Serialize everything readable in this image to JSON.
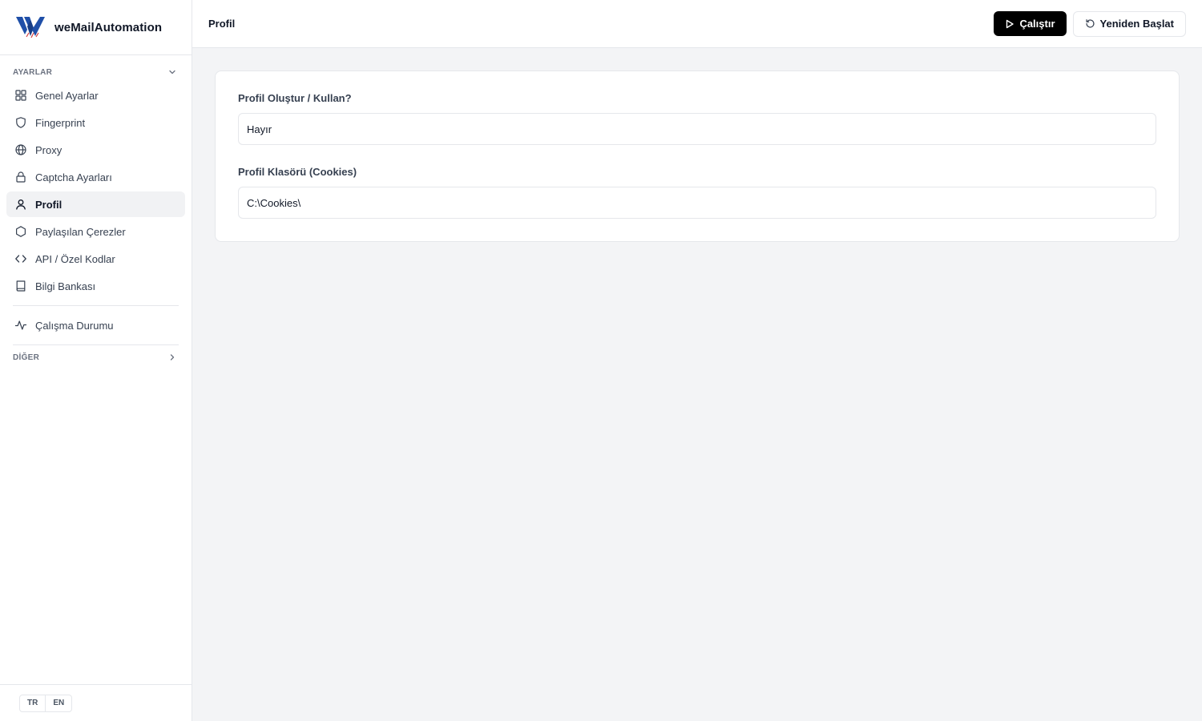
{
  "brand": {
    "name": "weMailAutomation"
  },
  "sidebar": {
    "section_settings": "AYARLAR",
    "items": [
      {
        "label": "Genel Ayarlar",
        "icon": "grid-icon"
      },
      {
        "label": "Fingerprint",
        "icon": "shield-icon"
      },
      {
        "label": "Proxy",
        "icon": "globe-icon"
      },
      {
        "label": "Captcha Ayarları",
        "icon": "lock-icon"
      },
      {
        "label": "Profil",
        "icon": "user-icon",
        "active": true
      },
      {
        "label": "Paylaşılan Çerezler",
        "icon": "hexagon-icon"
      },
      {
        "label": "API / Özel Kodlar",
        "icon": "code-icon"
      },
      {
        "label": "Bilgi Bankası",
        "icon": "book-icon"
      }
    ],
    "status_item": {
      "label": "Çalışma Durumu",
      "icon": "activity-icon"
    },
    "section_other": "DİĞER",
    "languages": [
      "TR",
      "EN"
    ]
  },
  "header": {
    "title": "Profil",
    "run_label": "Çalıştır",
    "restart_label": "Yeniden Başlat"
  },
  "form": {
    "profile_create_label": "Profil Oluştur / Kullan?",
    "profile_create_value": "Hayır",
    "profile_folder_label": "Profil Klasörü (Cookies)",
    "profile_folder_value": "C:\\Cookies\\"
  },
  "colors": {
    "accent": "#000000",
    "active_bg": "#f1f2f4",
    "page_bg": "#f3f4f6",
    "logo_blue": "#1f4fa8",
    "logo_red": "#d43c3c"
  }
}
